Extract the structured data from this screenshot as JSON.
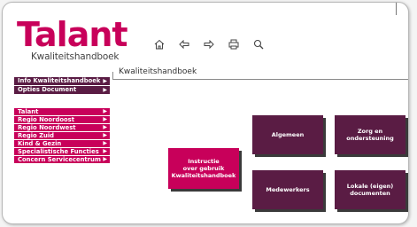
{
  "logo": {
    "word": "Talant",
    "subtitle": "Kwaliteitshandboek"
  },
  "toolbar": {
    "icons": [
      "home-icon",
      "back-icon",
      "forward-icon",
      "print-icon",
      "search-icon"
    ]
  },
  "page": {
    "title": "Kwaliteitshandboek"
  },
  "menu_top": [
    {
      "label": "Info Kwaliteitshandboek",
      "arrow": "▶"
    },
    {
      "label": "Opties Document",
      "arrow": "▶"
    }
  ],
  "menu_main": [
    {
      "label": "Talant",
      "arrow": "▶"
    },
    {
      "label": "Regio Noordoost",
      "arrow": "▶"
    },
    {
      "label": "Regio Noordwest",
      "arrow": "▶"
    },
    {
      "label": "Regio Zuid",
      "arrow": "▶"
    },
    {
      "label": "Kind & Gezin",
      "arrow": "▶"
    },
    {
      "label": "Specialistische Functies",
      "arrow": "▶"
    },
    {
      "label": "Concern Servicecentrum",
      "arrow": "▶"
    }
  ],
  "tiles": {
    "algemeen": {
      "line1": "Algemeen",
      "line2": "",
      "line3": ""
    },
    "zorg": {
      "line1": "Zorg en",
      "line2": "ondersteuning",
      "line3": ""
    },
    "instructie": {
      "line1": "Instructie",
      "line2": "over gebruik",
      "line3": "Kwaliteitshandboek"
    },
    "medewerkers": {
      "line1": "Medewerkers",
      "line2": "",
      "line3": ""
    },
    "lokale": {
      "line1": "Lokale (eigen)",
      "line2": "documenten",
      "line3": ""
    }
  },
  "colors": {
    "brand_pink": "#c8005a",
    "brand_purple": "#5a1c44"
  }
}
